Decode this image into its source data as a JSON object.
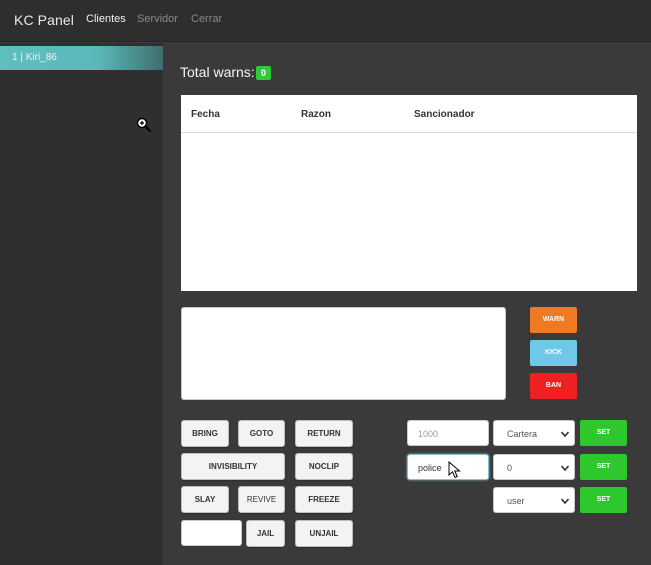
{
  "navbar": {
    "brand": "KC Panel",
    "links": [
      {
        "label": "Clientes",
        "active": true
      },
      {
        "label": "Servidor",
        "active": false
      },
      {
        "label": "Cerrar",
        "active": false
      }
    ]
  },
  "sidebar": {
    "clients": [
      {
        "label": "1 | Kiri_86",
        "selected": true
      }
    ]
  },
  "warns": {
    "title": "Total warns:",
    "count": "0",
    "table": {
      "headers": [
        "Fecha",
        "Razon",
        "Sancionador"
      ],
      "rows": []
    }
  },
  "reason": {
    "value": ""
  },
  "actions": {
    "warn": "WARN",
    "kick": "KICK",
    "ban": "BAN"
  },
  "commands": {
    "bring": "BRING",
    "goto": "GOTO",
    "return": "RETURN",
    "invisibility": "INVISIBILITY",
    "noclip": "NOCLIP",
    "slay": "SLAY",
    "revive": "REVIVE",
    "freeze": "FREEZE",
    "jail_time": "",
    "jail": "JAIL",
    "unjail": "UNJAIL"
  },
  "setters": [
    {
      "input": "1000",
      "input_is_placeholder": true,
      "select": "Cartera",
      "button": "SET"
    },
    {
      "input": "police",
      "input_is_placeholder": false,
      "select": "0",
      "button": "SET"
    },
    {
      "select": "user",
      "button": "SET"
    }
  ],
  "colors": {
    "accent_teal": "#5fbfbe",
    "warn": "#f07a21",
    "kick": "#6ec8e6",
    "ban": "#ee2020",
    "set": "#2ec82e",
    "badge": "#2fc93a"
  },
  "icons": {
    "cursor_zoom": "zoom-in-cursor-icon",
    "cursor_arrow": "arrow-cursor-icon",
    "select_chevron": "chevron-down-icon"
  }
}
